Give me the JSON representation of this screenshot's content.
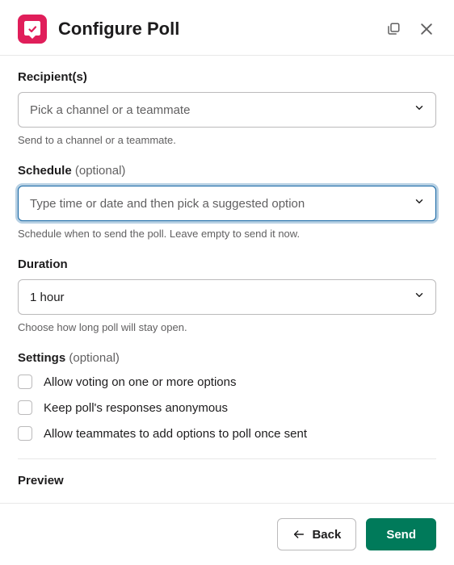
{
  "header": {
    "title": "Configure Poll"
  },
  "recipients": {
    "label": "Recipient(s)",
    "placeholder": "Pick a channel or a teammate",
    "help": "Send to a channel or a teammate."
  },
  "schedule": {
    "label": "Schedule",
    "optional": "(optional)",
    "placeholder": "Type time or date and then pick a suggested option",
    "help": "Schedule when to send the poll. Leave empty to send it now."
  },
  "duration": {
    "label": "Duration",
    "value": "1 hour",
    "help": "Choose how long poll will stay open."
  },
  "settings": {
    "label": "Settings",
    "optional": "(optional)",
    "options": [
      {
        "label": "Allow voting on one or more options"
      },
      {
        "label": "Keep poll's responses anonymous"
      },
      {
        "label": "Allow teammates to add options to poll once sent"
      }
    ]
  },
  "preview": {
    "label": "Preview"
  },
  "footer": {
    "back": "Back",
    "send": "Send"
  }
}
